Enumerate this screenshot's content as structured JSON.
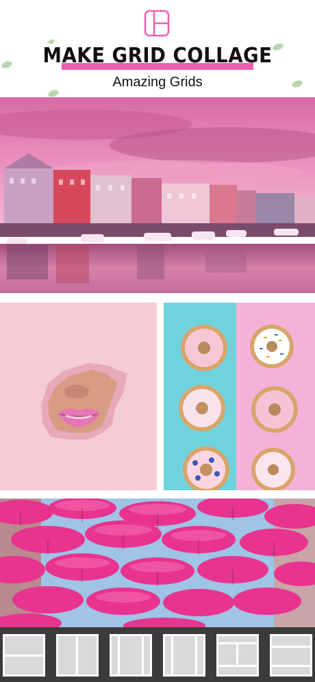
{
  "header": {
    "title": "MAKE GRID COLLAGE",
    "subtitle": "Amazing Grids",
    "accent_color": "#ee5fb0",
    "logo_icon": "grid-layout-icon"
  },
  "photos": [
    {
      "name": "pink-harbor-city-photo"
    },
    {
      "name": "lips-through-paper-photo"
    },
    {
      "name": "donuts-on-blue-pink-photo"
    },
    {
      "name": "pink-umbrellas-street-photo"
    }
  ],
  "toolbar": {
    "templates": [
      {
        "name": "layout-template-1",
        "icon": "two-rows-grid-icon"
      },
      {
        "name": "layout-template-2",
        "icon": "two-columns-grid-icon"
      },
      {
        "name": "layout-template-3",
        "icon": "three-columns-grid-icon"
      },
      {
        "name": "layout-template-4",
        "icon": "three-columns-grid-icon"
      },
      {
        "name": "layout-template-5",
        "icon": "mixed-rows-grid-icon"
      },
      {
        "name": "layout-template-6",
        "icon": "three-rows-grid-icon"
      }
    ]
  }
}
